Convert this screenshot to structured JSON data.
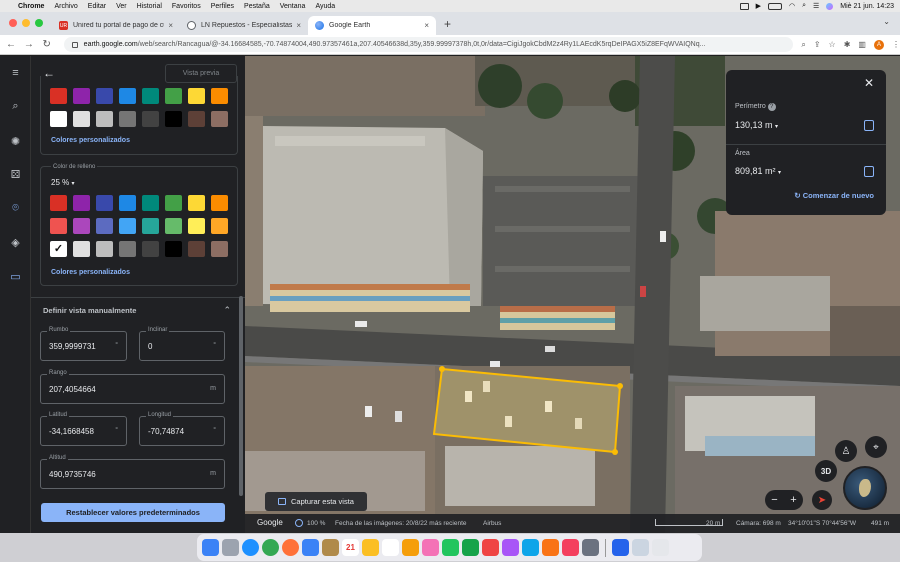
{
  "menubar": {
    "items": [
      "Chrome",
      "Archivo",
      "Editar",
      "Ver",
      "Historial",
      "Favoritos",
      "Perfiles",
      "Pestaña",
      "Ventana",
      "Ayuda"
    ],
    "clock": "Miè 21 jun.  14:23"
  },
  "tabs": [
    {
      "title": "Unired tu portal de pago de cu",
      "fav_color": "#d93025",
      "fav_text": "UR"
    },
    {
      "title": "LN Repuestos - Especialistas e",
      "fav_color": "#5f6368",
      "fav_text": ""
    },
    {
      "title": "Google Earth",
      "fav_color": "#1a73e8",
      "fav_text": ""
    }
  ],
  "address": {
    "domain": "earth.google.com",
    "path": "/web/search/Rancagua/@-34.16684585,-70.74874004,490.97357461a,207.40546638d,35y,359.99997378h,0t,0r/data=CigiJgokCbdM2z4Ry1LAEcdK5rqDeIPAGX5iZ8EFqWVAIQNq...",
    "profile": "A"
  },
  "panel": {
    "preview_label": "Vista previa",
    "custom_colors": "Colores personalizados",
    "fill_label": "Color de relleno",
    "fill_opacity": "25 %",
    "custom_colors_2": "Colores personalizados",
    "manual_view": "Definir vista manualmente",
    "fields": {
      "heading": {
        "label": "Rumbo",
        "value": "359,9999731",
        "unit": "°"
      },
      "tilt": {
        "label": "Inclinar",
        "value": "0",
        "unit": "°"
      },
      "range": {
        "label": "Rango",
        "value": "207,4054664",
        "unit": "m"
      },
      "latitude": {
        "label": "Latitud",
        "value": "-34,1668458",
        "unit": "°"
      },
      "longitude": {
        "label": "Longitud",
        "value": "-70,74874",
        "unit": "°"
      },
      "altitude": {
        "label": "Altitud",
        "value": "490,9735746",
        "unit": "m"
      }
    },
    "reset_label": "Restablecer valores predeterminados"
  },
  "palette_top": [
    [
      "#d93025",
      "#8e24aa",
      "#3949ab",
      "#1e88e5",
      "#00897b",
      "#43a047",
      "#fdd835",
      "#fb8c00"
    ],
    [
      "#ffffff",
      "#e0e0e0",
      "#bdbdbd",
      "#757575",
      "#424242",
      "#000000",
      "#5d4037",
      "#8d6e63"
    ]
  ],
  "palette_fill": [
    [
      "#d93025",
      "#8e24aa",
      "#3949ab",
      "#1e88e5",
      "#00897b",
      "#43a047",
      "#fdd835",
      "#fb8c00"
    ],
    [
      "#ef5350",
      "#ab47bc",
      "#5c6bc0",
      "#42a5f5",
      "#26a69a",
      "#66bb6a",
      "#ffee58",
      "#ffa726"
    ],
    [
      "#ffffff",
      "#e0e0e0",
      "#bdbdbd",
      "#757575",
      "#424242",
      "#000000",
      "#5d4037",
      "#8d6e63"
    ]
  ],
  "measure": {
    "perimeter_label": "Perímetro",
    "perimeter_value": "130,13 m",
    "area_label": "Área",
    "area_value": "809,81 m²",
    "restart_label": "Comenzar de nuevo"
  },
  "map": {
    "capture_label": "Capturar esta vista",
    "button_3d": "3D",
    "status": {
      "google": "Google",
      "loading": "100 %",
      "date": "Fecha de las imágenes: 20/8/22 más reciente",
      "source": "Airbus",
      "scale": "20 m",
      "camera": "Cámara: 698 m",
      "coords": "34°10'01\"S 70°44'56\"W",
      "elev": "491 m"
    }
  },
  "dock": {
    "icons": [
      {
        "name": "finder-icon",
        "color": "#3b82f6"
      },
      {
        "name": "launchpad-icon",
        "color": "#9ca3af"
      },
      {
        "name": "safari-icon",
        "color": "#1e90ff"
      },
      {
        "name": "chrome-icon",
        "color": "#34a853"
      },
      {
        "name": "firefox-icon",
        "color": "#ff7139"
      },
      {
        "name": "mail-icon",
        "color": "#3b82f6"
      },
      {
        "name": "notes-icon",
        "color": "#b08a4a"
      },
      {
        "name": "calendar-icon",
        "color": "#ffffff"
      },
      {
        "name": "memo-icon",
        "color": "#fbbf24"
      },
      {
        "name": "reminders-icon",
        "color": "#ffffff"
      },
      {
        "name": "pages-icon",
        "color": "#f59e0b"
      },
      {
        "name": "photos-icon",
        "color": "#f472b6"
      },
      {
        "name": "messages-icon",
        "color": "#22c55e"
      },
      {
        "name": "facetime-icon",
        "color": "#16a34a"
      },
      {
        "name": "music-icon",
        "color": "#ef4444"
      },
      {
        "name": "podcasts-icon",
        "color": "#a855f7"
      },
      {
        "name": "appstore-icon",
        "color": "#0ea5e9"
      },
      {
        "name": "books-icon",
        "color": "#f97316"
      },
      {
        "name": "preview-icon",
        "color": "#f43f5e"
      },
      {
        "name": "settings-icon",
        "color": "#6b7280"
      },
      {
        "name": "word-icon",
        "color": "#2563eb"
      },
      {
        "name": "screenshot-icon",
        "color": "#cbd5e1"
      },
      {
        "name": "trash-icon",
        "color": "#e5e7eb"
      }
    ],
    "calendar_day": "21"
  }
}
